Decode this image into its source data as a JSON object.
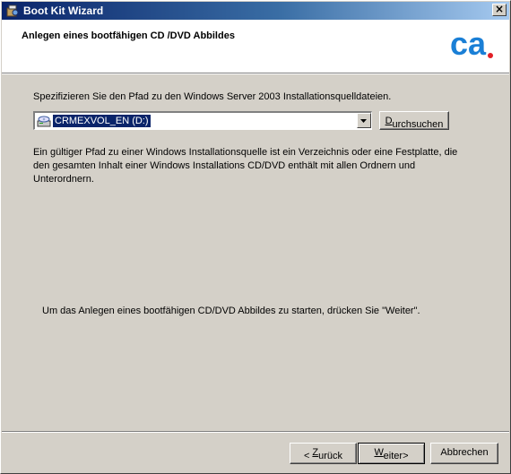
{
  "window": {
    "title": "Boot Kit Wizard",
    "close_label": "×"
  },
  "header": {
    "title": "Anlegen eines bootfähigen CD /DVD Abbildes",
    "logo_text": "ca",
    "logo_color": "#1a7fd6",
    "logo_dot_color": "#e21f26"
  },
  "main": {
    "prompt": "Spezifizieren Sie den Pfad zu den Windows Server 2003 Installationsquelldateien.",
    "path_combo": {
      "value": "CRMEXVOL_EN (D:)",
      "icon": "cd-drive-icon"
    },
    "browse_button": {
      "prefix": "",
      "accel": "D",
      "rest": "urchsuchen"
    },
    "description": "Ein gültiger Pfad zu einer Windows Installationsquelle ist ein Verzeichnis oder eine Festplatte, die den gesamten Inhalt einer Windows Installations CD/DVD enthält mit allen Ordnern und Unterordnern.",
    "instruction": "Um das Anlegen eines bootfähigen CD/DVD Abbildes  zu starten, drücken Sie \"Weiter\"."
  },
  "footer": {
    "back_button": {
      "prefix": "< ",
      "accel": "Z",
      "rest": "urück"
    },
    "next_button": {
      "prefix": "",
      "accel": "W",
      "rest": "eiter>"
    },
    "cancel_button": {
      "label": "Abbrechen"
    }
  },
  "colors": {
    "dialog_face": "#d4d0c8",
    "title_gradient_start": "#0a246a",
    "selection": "#0a246a"
  }
}
